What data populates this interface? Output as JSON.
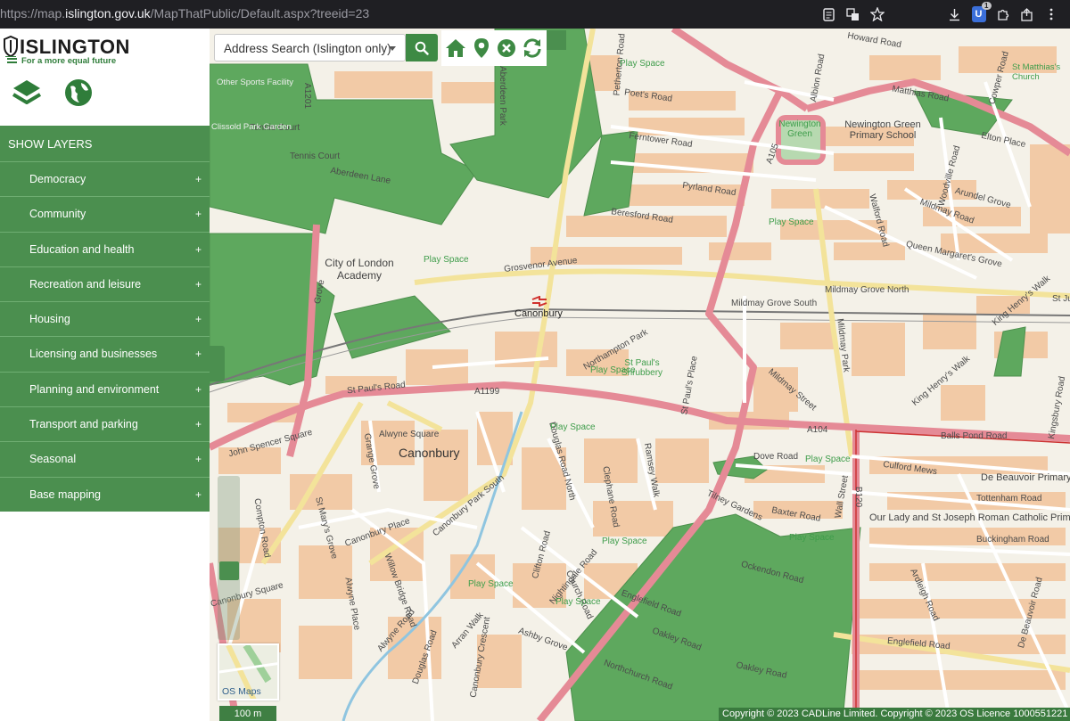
{
  "browser": {
    "url_prefix": "https://map.",
    "url_domain": "islington.gov.uk",
    "url_path": "/MapThatPublic/Default.aspx?treeid=23",
    "extension_badge_count": "1"
  },
  "sidebar": {
    "logo_text": "ISLINGTON",
    "logo_tagline": "For a more equal future",
    "show_layers_label": "SHOW LAYERS",
    "layers": [
      {
        "label": "Democracy",
        "toggle": "+"
      },
      {
        "label": "Community",
        "toggle": "+"
      },
      {
        "label": "Education and health",
        "toggle": "+"
      },
      {
        "label": "Recreation and leisure",
        "toggle": "+"
      },
      {
        "label": "Housing",
        "toggle": "+"
      },
      {
        "label": "Licensing and businesses",
        "toggle": "+"
      },
      {
        "label": "Planning and environment",
        "toggle": "+"
      },
      {
        "label": "Transport and parking",
        "toggle": "+"
      },
      {
        "label": "Seasonal",
        "toggle": "+"
      },
      {
        "label": "Base mapping",
        "toggle": "+"
      }
    ]
  },
  "toolbar": {
    "search_selected": "Address Search (Islington only)",
    "tools": [
      "home-icon",
      "location-pin-icon",
      "clear-icon",
      "refresh-icon"
    ]
  },
  "map": {
    "area_label": "Canonbury",
    "station_label": "Canonbury",
    "places": {
      "city_of_london_academy": "City of London Academy",
      "newington_green": "Newington Green",
      "newington_green_primary": "Newington Green Primary School",
      "st_matthias": "St Matthias's Church",
      "st_pauls_shrubbery": "St Paul's Shrubbery",
      "de_beauvoir_primary": "De Beauvoir Primary School",
      "our_lady": "Our Lady and St Joseph Roman Catholic Primary",
      "other_sports_facility": "Other Sports Facility",
      "clissold_park_garden": "Clissold Park Garden"
    },
    "roads": {
      "grosvenor_avenue": "Grosvenor Avenue",
      "st_pauls_road": "St Paul's Road",
      "a1199": "A1199",
      "a104": "A104",
      "a105": "A105",
      "a1201": "A1201",
      "b120": "B120",
      "mildmay_grove_north": "Mildmay Grove North",
      "mildmay_grove_south": "Mildmay Grove South",
      "mildmay_park": "Mildmay Park",
      "mildmay_street": "Mildmay Street",
      "mildmay_road": "Mildmay Road",
      "northampton_park": "Northampton Park",
      "st_pauls_place": "St Paul's Place",
      "balls_pond_road": "Balls Pond Road",
      "canonbury_park_south": "Canonbury Park South",
      "canonbury_park_north": "Canonbury Park North",
      "canonbury_place": "Canonbury Place",
      "canonbury_square": "Canonbury Square",
      "canonbury_crescent": "Canonbury Crescent",
      "canonbury_grove": "Canonbury Grove",
      "alwyne_place": "Alwyne Place",
      "alwyne_villas": "Alwyne Villas",
      "alwyne_square": "Alwyne Square",
      "alwyne_road": "Alwyne Road",
      "grange_grove": "Grange Grove",
      "john_spencer_square": "John Spencer Square",
      "st_marys_grove": "St Mary's Grove",
      "compton_road": "Compton Road",
      "willow_bridge_road": "Willow Bridge Road",
      "douglas_road": "Douglas Road",
      "douglas_road_north": "Douglas Road North",
      "clephane_road": "Clephane Road",
      "ramsey_walk": "Ramsey Walk",
      "clifton_road": "Clifton Road",
      "nightingale_road": "Nightingale Road",
      "church_road": "Church Road",
      "arran_walk": "Arran Walk",
      "ashby_grove": "Ashby Grove",
      "englefield_road": "Englefield Road",
      "oakley_road": "Oakley Road",
      "northchurch_road": "Northchurch Road",
      "ockendon_road": "Ockendon Road",
      "baxter_road": "Baxter Road",
      "tilney_gardens": "Tilney Gardens",
      "dove_road": "Dove Road",
      "wall_street": "Wall Street",
      "culford_mews": "Culford Mews",
      "culford_road": "Culford Road",
      "tottenham_road": "Tottenham Road",
      "buckingham_road": "Buckingham Road",
      "de_beauvoir_road": "De Beauvoir Road",
      "ardleigh_road": "Ardleigh Road",
      "kingsbury_road": "Kingsbury Road",
      "king_henrys_walk": "King Henry's Walk",
      "queen_margarets_grove": "Queen Margaret's Grove",
      "walford_road": "Walford Road",
      "arundel_grove": "Arundel Grove",
      "woodville_road": "Woodville Road",
      "elton_place": "Elton Place",
      "howard_road": "Howard Road",
      "matthias_road": "Matthias Road",
      "cowper_road": "Cowper Road",
      "pyrland_road": "Pyrland Road",
      "beresford_road": "Beresford Road",
      "ferntower_road": "Ferntower Road",
      "poets_road": "Poet's Road",
      "petherton_road": "Petherton Road",
      "aberdeen_lane": "Aberdeen Lane",
      "aberdeen_park": "Aberdeen Park",
      "albion_road": "Albion Road",
      "tennis_court": "Tennis Court",
      "grove": "Grove",
      "st_judes": "St Jud"
    },
    "play_space": "Play Space"
  },
  "controls": {
    "osmaps_label": "OS Maps",
    "scale_label": "100 m",
    "copyright": "Copyright © 2023 CADLine Limited. Copyright © 2023 OS Licence 1000551221"
  },
  "colors": {
    "brand_green": "#4b8f4f",
    "park_green": "#5fa55f",
    "building": "#f1c9a6",
    "road_pink": "#e58a96",
    "road_yellow": "#f3e39a"
  }
}
